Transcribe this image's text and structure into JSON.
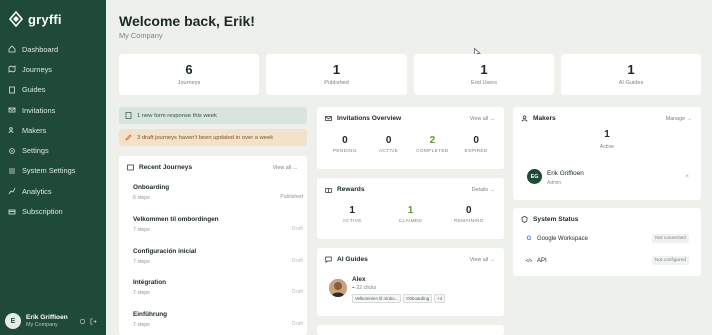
{
  "brand": {
    "name": "gryffi"
  },
  "nav": [
    {
      "label": "Dashboard",
      "icon": "home-icon"
    },
    {
      "label": "Journeys",
      "icon": "map-icon"
    },
    {
      "label": "Guides",
      "icon": "book-icon"
    },
    {
      "label": "Invitations",
      "icon": "mail-icon"
    },
    {
      "label": "Makers",
      "icon": "users-icon"
    },
    {
      "label": "Settings",
      "icon": "gear-icon"
    },
    {
      "label": "System Settings",
      "icon": "sliders-icon"
    },
    {
      "label": "Analytics",
      "icon": "chart-icon"
    },
    {
      "label": "Subscription",
      "icon": "card-icon"
    }
  ],
  "user": {
    "initial": "E",
    "name": "Erik Griffioen",
    "company": "My Company"
  },
  "header": {
    "title": "Welcome back, Erik!",
    "subtitle": "My Company"
  },
  "stats": [
    {
      "value": "6",
      "label": "Journeys"
    },
    {
      "value": "1",
      "label": "Published"
    },
    {
      "value": "1",
      "label": "End Users"
    },
    {
      "value": "1",
      "label": "AI Guides"
    }
  ],
  "notices": {
    "form": "1 new form response this week",
    "draft": "3 draft journeys haven't been updated in over a week"
  },
  "recent": {
    "title": "Recent Journeys",
    "link": "View all →",
    "items": [
      {
        "name": "Onboarding",
        "steps": "6 steps",
        "status": "Published"
      },
      {
        "name": "Velkommen til ombordingen",
        "steps": "7 steps",
        "status": "Draft"
      },
      {
        "name": "Configuración inicial",
        "steps": "7 steps",
        "status": "Draft"
      },
      {
        "name": "Intégration",
        "steps": "7 steps",
        "status": "Draft"
      },
      {
        "name": "Einführung",
        "steps": "7 steps",
        "status": "Draft"
      }
    ]
  },
  "invitations": {
    "title": "Invitations Overview",
    "link": "View all →",
    "metrics": [
      {
        "value": "0",
        "label": "PENDING"
      },
      {
        "value": "0",
        "label": "ACTIVE"
      },
      {
        "value": "2",
        "label": "COMPLETED"
      },
      {
        "value": "0",
        "label": "EXPIRED"
      }
    ]
  },
  "rewards": {
    "title": "Rewards",
    "link": "Details →",
    "metrics": [
      {
        "value": "1",
        "label": "ACTIVE"
      },
      {
        "value": "1",
        "label": "CLAIMED"
      },
      {
        "value": "0",
        "label": "REMAINING"
      }
    ]
  },
  "guides": {
    "title": "AI Guides",
    "link": "View all →",
    "item": {
      "name": "Alex",
      "clicks": "22 clicks",
      "tags": [
        "Velkommen til ombo...",
        "Onboarding",
        "+4"
      ]
    }
  },
  "makers": {
    "title": "Makers",
    "link": "Manage →",
    "count": "1",
    "count_label": "Active",
    "person": {
      "initials": "EG",
      "name": "Erik Griffioen",
      "role": "Admin"
    }
  },
  "system": {
    "title": "System Status",
    "rows": [
      {
        "name": "Google Workspace",
        "status": "Not connected",
        "icon": "google-icon",
        "glyph": "G"
      },
      {
        "name": "API",
        "status": "Not configured",
        "icon": "code-icon",
        "glyph": "</>"
      }
    ]
  },
  "colors": {
    "sidebar": "#1f4a37",
    "background": "#eef0eb",
    "green": "#5c9a3a"
  }
}
